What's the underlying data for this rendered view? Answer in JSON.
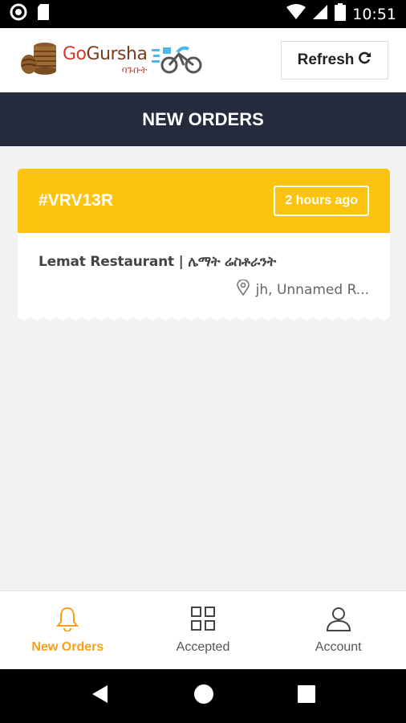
{
  "status_bar": {
    "time": "10:51"
  },
  "header": {
    "logo_go": "Go",
    "logo_gursha": "Gursha",
    "logo_sub": "ባጉቡት",
    "refresh_label": "Refresh",
    "refresh_icon": "refresh-icon"
  },
  "page": {
    "title": "NEW ORDERS"
  },
  "orders": [
    {
      "id": "#VRV13R",
      "time_ago": "2 hours ago",
      "restaurant": "Lemat Restaurant | ሌማት ሬስቶራንት",
      "address": "jh, Unnamed R..."
    }
  ],
  "bottom_nav": {
    "items": [
      {
        "label": "New Orders",
        "icon": "bell-icon",
        "active": true
      },
      {
        "label": "Accepted",
        "icon": "grid-icon",
        "active": false
      },
      {
        "label": "Account",
        "icon": "user-icon",
        "active": false
      }
    ]
  },
  "colors": {
    "accent": "#fcc30f",
    "active_nav": "#f6a01a",
    "title_bar": "#252a3c"
  }
}
